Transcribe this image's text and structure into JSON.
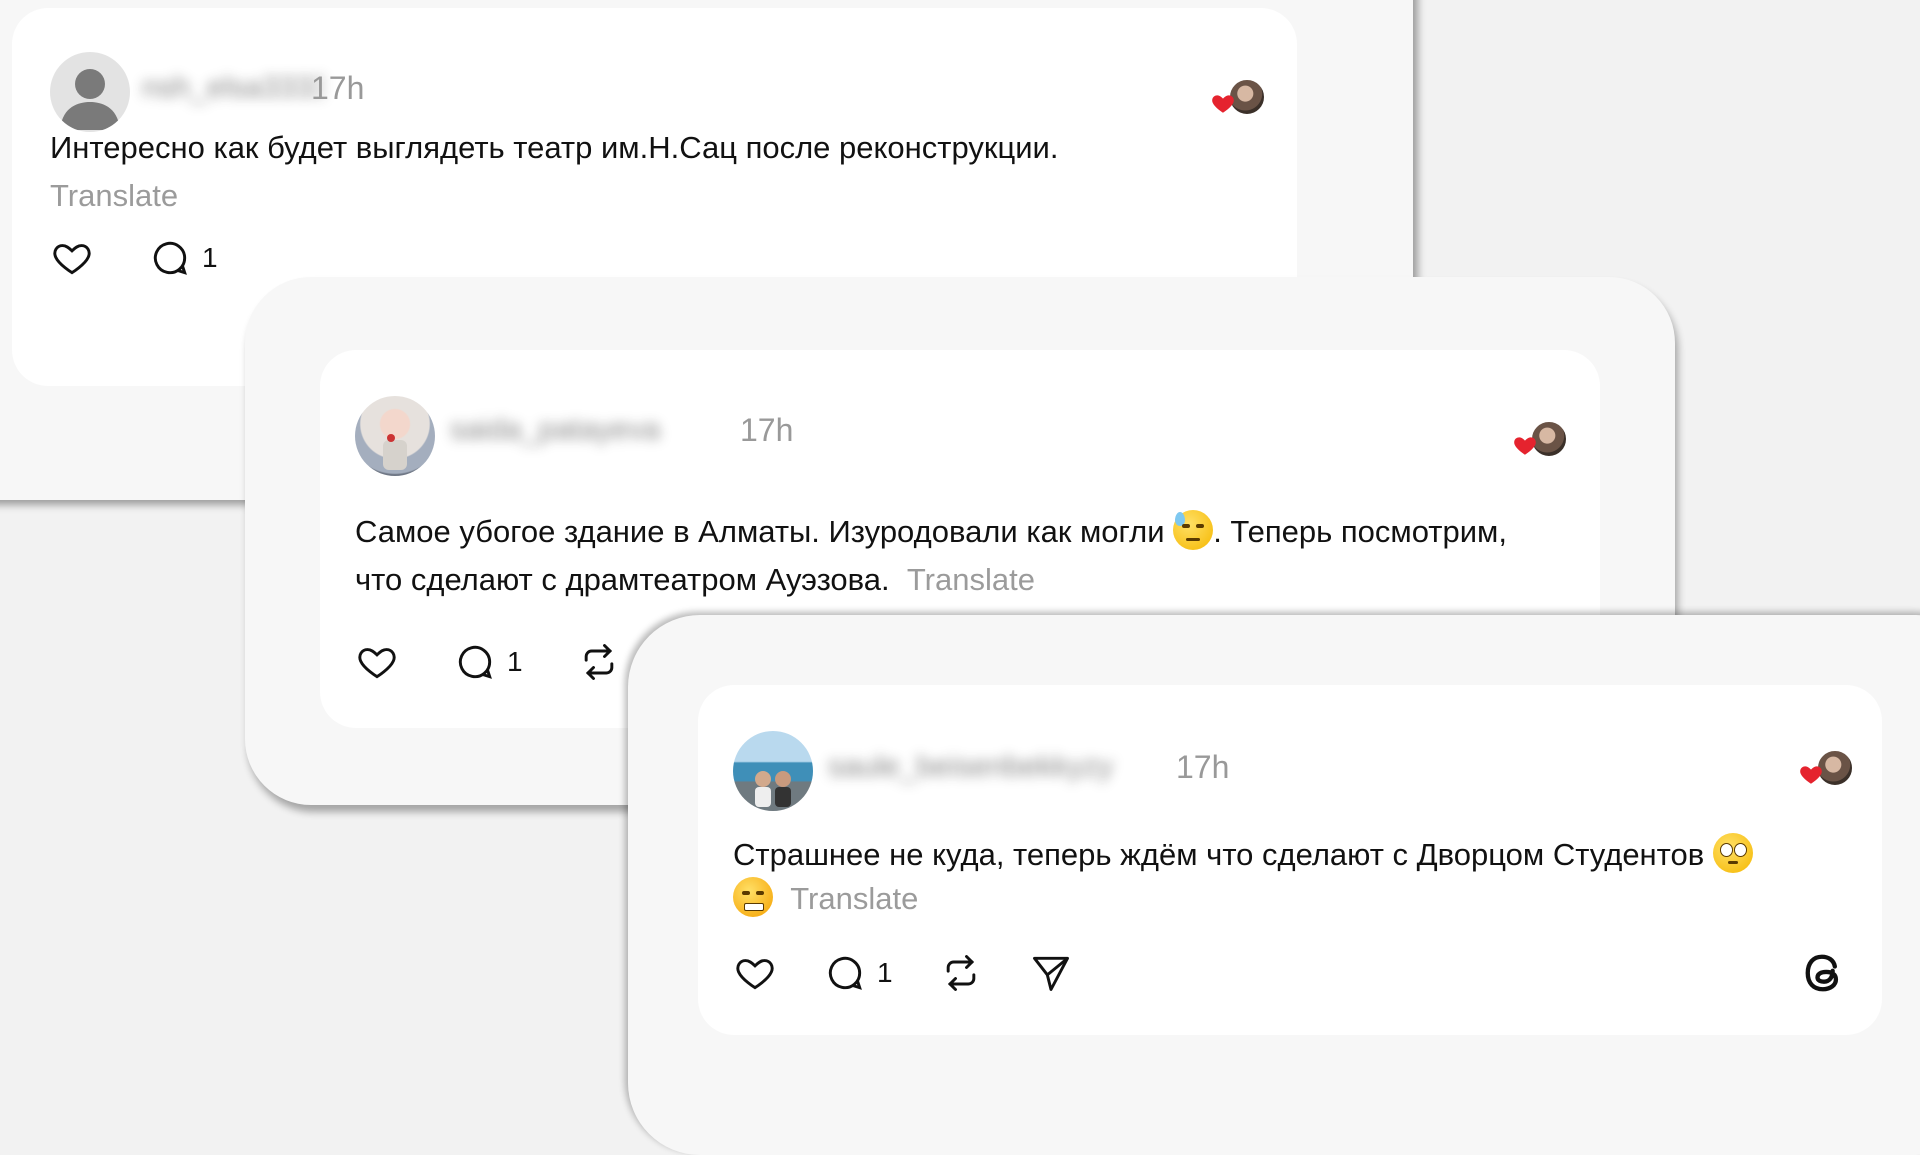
{
  "colors": {
    "background": "#f2f2f2",
    "card": "#ffffff",
    "heart": "#e5232e",
    "muted_text": "#9b9b9b"
  },
  "posts": [
    {
      "username": "nsh_elsa33333",
      "time": "17h",
      "text": "Интересно как будет выглядеть театр им.Н.Сац после реконструкции.",
      "translate_label": "Translate",
      "reply_count": "1",
      "avatar_icon": "default-user-icon"
    },
    {
      "username": "saida_patayeva",
      "time": "17h",
      "text_part1": "Самое убогое здание в Алматы. Изуродовали как могли",
      "text_part2": ". Теперь посмотрим, что сделают с драмтеатром Ауэзова.",
      "translate_label": "Translate",
      "reply_count": "1",
      "emoji": "downcast-sweat-face"
    },
    {
      "username": "saule_beisenbekkyzy",
      "time": "17h",
      "text": "Страшнее не куда, теперь ждём что сделают с Дворцом Студентов",
      "translate_label": "Translate",
      "reply_count": "1",
      "emojis": [
        "face-with-rolling-eyes",
        "face-with-steam-from-nose"
      ]
    }
  ],
  "brand": {
    "logo_icon": "threads-logo-icon"
  }
}
